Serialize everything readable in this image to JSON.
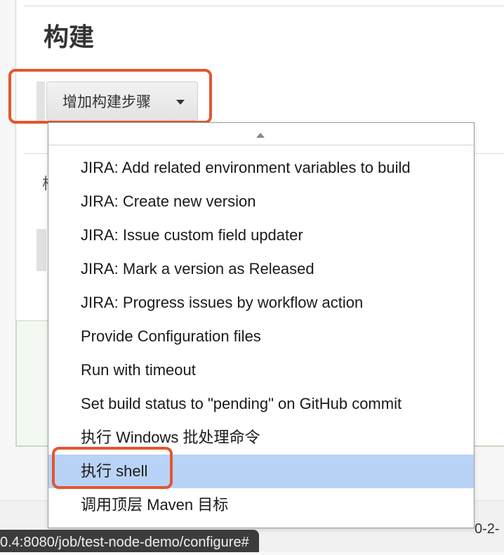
{
  "section": {
    "title": "构建",
    "add_step_label": "增加构建步骤",
    "hidden_label": "构"
  },
  "dropdown": {
    "items": [
      {
        "label": "JIRA: Add related environment variables to build"
      },
      {
        "label": "JIRA: Create new version"
      },
      {
        "label": "JIRA: Issue custom field updater"
      },
      {
        "label": "JIRA: Mark a version as Released"
      },
      {
        "label": "JIRA: Progress issues by workflow action"
      },
      {
        "label": "Provide Configuration files"
      },
      {
        "label": "Run with timeout"
      },
      {
        "label": "Set build status to \"pending\" on GitHub commit"
      },
      {
        "label": "执行 Windows 批处理命令"
      },
      {
        "label": "执行 shell"
      },
      {
        "label": "调用顶层 Maven 目标"
      }
    ],
    "selected_label": "执行 shell"
  },
  "status_bar": {
    "url": "0.4:8080/job/test-node-demo/configure#"
  },
  "footer": {
    "right_text": "0-2-"
  },
  "colors": {
    "highlight": "#e2572f",
    "selected_row": "#b9d3f7"
  }
}
